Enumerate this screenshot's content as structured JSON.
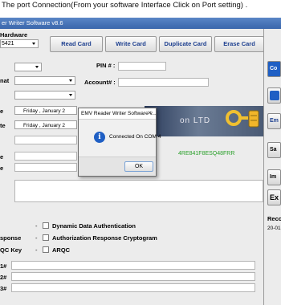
{
  "caption": "The port Connection(From your software Interface Click on Port setting) .",
  "window": {
    "title": "er Writer Software v8.6",
    "hardware_label": "Hardware",
    "hardware_value": "5421"
  },
  "toolbar": {
    "read_label": "Read Card",
    "write_label": "Write Card",
    "duplicate_label": "Duplicate Card",
    "erase_label": "Erase Card"
  },
  "form": {
    "pin_label": "PIN # :",
    "account_label": "Account# :",
    "format_label": "nat",
    "date1_label": "e",
    "date2_label": "te",
    "date1_value": "Friday  ,  January  2",
    "date2_value": "Friday  ,  January  2",
    "label_e1": "e",
    "label_e2": "e",
    "track_text": "4RE841F8ESQ48FRR",
    "banner_text": "on LTD"
  },
  "options": [
    {
      "left_label": "",
      "label": "Dynamic Data Authentication"
    },
    {
      "left_label": "sponse",
      "label": "Authorization Response Cryptogram"
    },
    {
      "left_label": "QC Key",
      "label": "ARQC"
    }
  ],
  "tracks": [
    "1#",
    "2#",
    "3#"
  ],
  "right_panel": {
    "btn1": "Co",
    "btn2": "Em",
    "btn3": "Sa",
    "btn4": "Im",
    "btn5": "Ex",
    "record_label": "Reco",
    "record_value": "20-01"
  },
  "dialog": {
    "title": "EMV Reader Writer Software v...",
    "close_glyph": "✕",
    "message": "Connected On COM 4",
    "ok_label": "OK"
  },
  "colors": {
    "titlebar": "#3a66ac",
    "button_text": "#1d3f8f",
    "track_text": "#2aa02a",
    "info_icon": "#1f5fc4"
  }
}
